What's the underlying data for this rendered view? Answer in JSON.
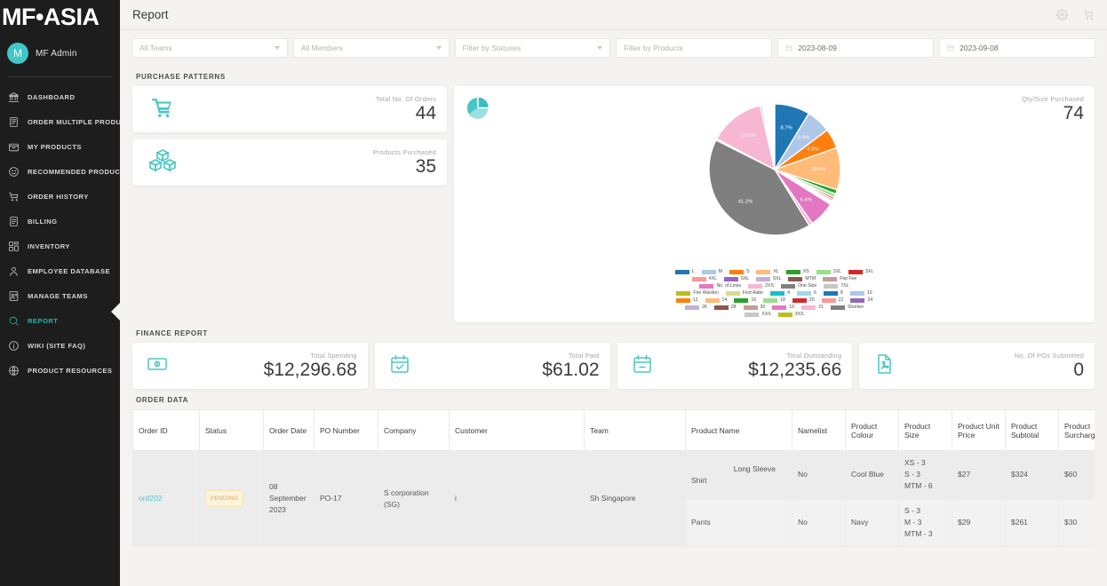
{
  "sidebar": {
    "brand": "MF•ASIA",
    "user": {
      "initial": "M",
      "name": "MF Admin"
    },
    "items": [
      {
        "label": "DASHBOARD",
        "icon": "bank-icon",
        "active": false
      },
      {
        "label": "ORDER MULTIPLE PRODUCTS",
        "icon": "list-icon",
        "active": false
      },
      {
        "label": "MY PRODUCTS",
        "icon": "box-icon",
        "active": false
      },
      {
        "label": "RECOMMENDED PRODUCTS",
        "icon": "smiley-icon",
        "active": false
      },
      {
        "label": "ORDER HISTORY",
        "icon": "cart-icon",
        "active": false
      },
      {
        "label": "BILLING",
        "icon": "invoice-icon",
        "active": false
      },
      {
        "label": "INVENTORY",
        "icon": "grid-icon",
        "active": false
      },
      {
        "label": "EMPLOYEE DATABASE",
        "icon": "person-icon",
        "active": false
      },
      {
        "label": "MANAGE TEAMS",
        "icon": "id-card-icon",
        "active": false
      },
      {
        "label": "REPORT",
        "icon": "search-icon",
        "active": true
      },
      {
        "label": "WIKI (SITE FAQ)",
        "icon": "info-icon",
        "active": false
      },
      {
        "label": "PRODUCT RESOURCES",
        "icon": "globe-icon",
        "active": false
      }
    ],
    "accent": "#21b6ad",
    "background": "#1d1d1d"
  },
  "header": {
    "title": "Report",
    "icons": [
      {
        "name": "gear-icon"
      },
      {
        "name": "cart-icon"
      }
    ]
  },
  "filters": {
    "team": {
      "placeholder": "All Teams",
      "value": ""
    },
    "member": {
      "placeholder": "All Members",
      "value": ""
    },
    "status": {
      "placeholder": "Filter by Statuses",
      "value": ""
    },
    "products": {
      "placeholder": "Filter by Products",
      "value": ""
    },
    "date_from": "2023-08-09",
    "date_to": "2023-09-08"
  },
  "purchase_patterns": {
    "section_title": "PURCHASE PATTERNS",
    "stats": [
      {
        "label": "Total No. Of Orders",
        "value": "44",
        "icon": "cart-icon"
      },
      {
        "label": "Products Purchased",
        "value": "35",
        "icon": "boxes-icon"
      }
    ],
    "chart_card": {
      "icon": "pie-chart-icon",
      "label": "Qty/Size Purchased",
      "value": "74"
    }
  },
  "chart_data": {
    "type": "pie",
    "title": "Qty/Size Purchased",
    "total": 74,
    "legend_position": "bottom",
    "labels": [
      "L",
      "M",
      "S",
      "XL",
      "XS",
      "2XL",
      "3XL",
      "4XL",
      "5XL",
      "6XL",
      "MTM",
      "Flat Fee",
      "No. of Lines",
      "2XS",
      "One Size",
      "7XL",
      "Fire Warden",
      "First Aider",
      "4",
      "6",
      "8",
      "10",
      "12",
      "14",
      "16",
      "18",
      "20",
      "22",
      "24",
      "26",
      "28",
      "30",
      "19",
      "21",
      "Shorten",
      "XXS",
      "3XS"
    ],
    "colors": [
      "#1f77b4",
      "#aec7e8",
      "#ff7f0e",
      "#ffbb78",
      "#2ca02c",
      "#98df8a",
      "#d62728",
      "#ff9896",
      "#9467bd",
      "#c5b0d5",
      "#8c564b",
      "#c49c94",
      "#e377c2",
      "#f7b6d2",
      "#7f7f7f",
      "#c7c7c7",
      "#bcbd22",
      "#dbdb8d",
      "#17becf",
      "#9edae5",
      "#1f77b4",
      "#aec7e8",
      "#ff7f0e",
      "#ffbb78",
      "#2ca02c",
      "#98df8a",
      "#d62728",
      "#ff9896",
      "#9467bd",
      "#c5b0d5",
      "#8c564b",
      "#c49c94",
      "#e377c2",
      "#f7b6d2",
      "#7f7f7f",
      "#c7c7c7",
      "#bcbd22"
    ],
    "visible_percent_labels": [
      "0.5%",
      "8.7%",
      "6.0%",
      "4.9%",
      "10.4%",
      "1.1%",
      "0.9%",
      "0.5%",
      "0.5%",
      "0.3%",
      "6.4%",
      "0.9%",
      "41.2%",
      "0.4%",
      "13.6%"
    ],
    "slices": [
      {
        "label": "L",
        "percent": 8.7,
        "color": "#1f77b4"
      },
      {
        "label": "M",
        "percent": 6.0,
        "color": "#aec7e8"
      },
      {
        "label": "S",
        "percent": 4.9,
        "color": "#ff7f0e"
      },
      {
        "label": "XL",
        "percent": 10.4,
        "color": "#ffbb78"
      },
      {
        "label": "XS",
        "percent": 1.1,
        "color": "#2ca02c"
      },
      {
        "label": "2XL",
        "percent": 0.9,
        "color": "#98df8a"
      },
      {
        "label": "3XL",
        "percent": 0.5,
        "color": "#d62728"
      },
      {
        "label": "4XL",
        "percent": 0.5,
        "color": "#ff9896"
      },
      {
        "label": "5XL",
        "percent": 0.3,
        "color": "#9467bd"
      },
      {
        "label": "6XL",
        "percent": 0.3,
        "color": "#c5b0d5"
      },
      {
        "label": "MTM",
        "percent": 0.3,
        "color": "#8c564b"
      },
      {
        "label": "No. of Lines",
        "percent": 6.4,
        "color": "#e377c2"
      },
      {
        "label": "2XS",
        "percent": 0.9,
        "color": "#f7b6d2"
      },
      {
        "label": "One Size",
        "percent": 41.2,
        "color": "#7f7f7f"
      },
      {
        "label": "7XL",
        "percent": 0.4,
        "color": "#c7c7c7"
      },
      {
        "label": "Flat Fee",
        "percent": 13.6,
        "color": "#f7b6d2"
      },
      {
        "label": "Shorten",
        "percent": 0.5,
        "color": "#aec7e8"
      }
    ],
    "legend_rows": [
      [
        {
          "label": "L",
          "color": "#1f77b4"
        },
        {
          "label": "M",
          "color": "#aec7e8"
        },
        {
          "label": "S",
          "color": "#ff7f0e"
        },
        {
          "label": "XL",
          "color": "#ffbb78"
        },
        {
          "label": "XS",
          "color": "#2ca02c"
        },
        {
          "label": "2XL",
          "color": "#98df8a"
        },
        {
          "label": "3XL",
          "color": "#d62728"
        }
      ],
      [
        {
          "label": "4XL",
          "color": "#ff9896"
        },
        {
          "label": "5XL",
          "color": "#9467bd"
        },
        {
          "label": "6XL",
          "color": "#c5b0d5"
        },
        {
          "label": "MTM",
          "color": "#8c564b"
        },
        {
          "label": "Flat Fee",
          "color": "#c49c94"
        }
      ],
      [
        {
          "label": "No. of Lines",
          "color": "#e377c2"
        },
        {
          "label": "2XS",
          "color": "#f7b6d2"
        },
        {
          "label": "One Size",
          "color": "#7f7f7f"
        },
        {
          "label": "7XL",
          "color": "#c7c7c7"
        }
      ],
      [
        {
          "label": "Fire Warden",
          "color": "#bcbd22"
        },
        {
          "label": "First Aider",
          "color": "#dbdb8d"
        },
        {
          "label": "4",
          "color": "#17becf"
        },
        {
          "label": "6",
          "color": "#9edae5"
        },
        {
          "label": "8",
          "color": "#1f77b4"
        },
        {
          "label": "10",
          "color": "#aec7e8"
        }
      ],
      [
        {
          "label": "12",
          "color": "#ff7f0e"
        },
        {
          "label": "14",
          "color": "#ffbb78"
        },
        {
          "label": "16",
          "color": "#2ca02c"
        },
        {
          "label": "18",
          "color": "#98df8a"
        },
        {
          "label": "20",
          "color": "#d62728"
        },
        {
          "label": "22",
          "color": "#ff9896"
        },
        {
          "label": "24",
          "color": "#9467bd"
        }
      ],
      [
        {
          "label": "26",
          "color": "#c5b0d5"
        },
        {
          "label": "28",
          "color": "#8c564b"
        },
        {
          "label": "30",
          "color": "#c49c94"
        },
        {
          "label": "19",
          "color": "#e377c2"
        },
        {
          "label": "21",
          "color": "#f7b6d2"
        },
        {
          "label": "Shorten",
          "color": "#7f7f7f"
        }
      ],
      [
        {
          "label": "XXS",
          "color": "#c7c7c7"
        },
        {
          "label": "3XS",
          "color": "#bcbd22"
        }
      ]
    ]
  },
  "finance": {
    "section_title": "FINANCE REPORT",
    "cards": [
      {
        "label": "Total Spending",
        "value": "$12,296.68",
        "icon": "money-icon"
      },
      {
        "label": "Total Paid",
        "value": "$61.02",
        "icon": "calendar-check-icon"
      },
      {
        "label": "Total Outstanding",
        "value": "$12,235.66",
        "icon": "calendar-minus-icon"
      },
      {
        "label": "No. Of POs Submitted",
        "value": "0",
        "icon": "pdf-icon"
      }
    ]
  },
  "order_data": {
    "section_title": "ORDER DATA",
    "columns": [
      "Order ID",
      "Status",
      "Order Date",
      "PO Number",
      "Company",
      "Customer",
      "Team",
      "Product Name",
      "Namelist",
      "Product Colour",
      "Product Size",
      "Product Unit Price",
      "Product Subtotal",
      "Product Surcharge"
    ],
    "rows": [
      {
        "order_id": "ord202",
        "status": "PENDING",
        "order_date": "08 September 2023",
        "po_number": "PO-17",
        "company": "S corporation (SG)",
        "customer": "i",
        "team": "Sh Singapore",
        "product_name_line1": "Long Sleeve",
        "product_name_line2": "Shirt",
        "namelist": "No",
        "product_colour": "Cool Blue",
        "product_size": "XS - 3\nS - 3\nMTM - 6",
        "unit_price": "$27",
        "subtotal": "$324",
        "surcharge": "$60"
      },
      {
        "product_name_line1": "Pants",
        "product_name_line2": "",
        "namelist": "No",
        "product_colour": "Navy",
        "product_size": "S - 3\nM - 3\nMTM - 3",
        "unit_price": "$29",
        "subtotal": "$261",
        "surcharge": "$30"
      }
    ]
  }
}
